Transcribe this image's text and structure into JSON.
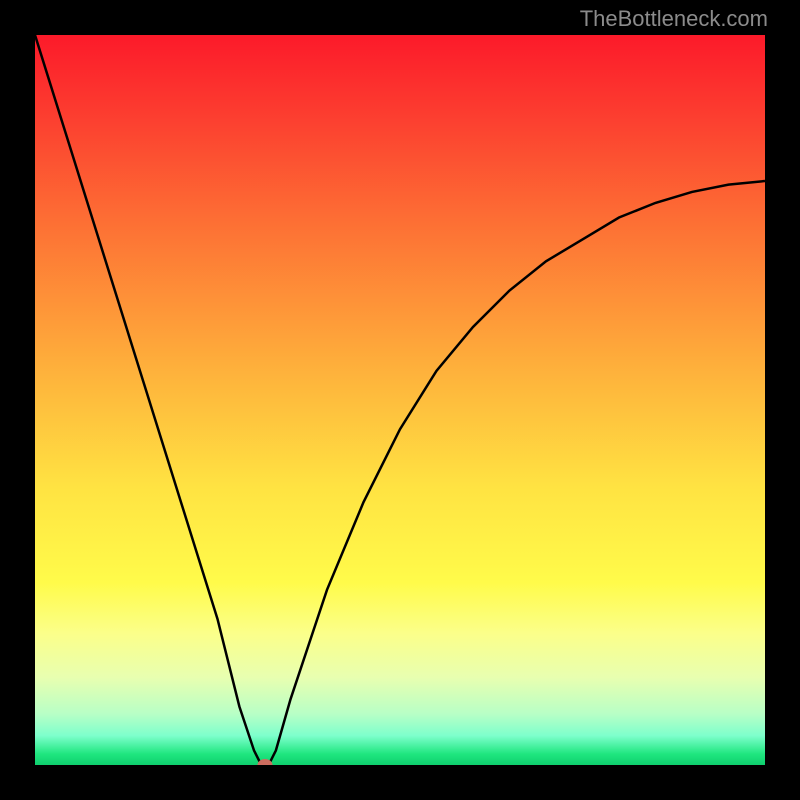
{
  "attribution": "TheBottleneck.com",
  "chart_data": {
    "type": "line",
    "title": "",
    "xlabel": "",
    "ylabel": "",
    "xlim": [
      0,
      100
    ],
    "ylim": [
      0,
      100
    ],
    "x": [
      0,
      5,
      10,
      15,
      20,
      25,
      28,
      30,
      31,
      32,
      33,
      35,
      40,
      45,
      50,
      55,
      60,
      65,
      70,
      75,
      80,
      85,
      90,
      95,
      100
    ],
    "values": [
      100,
      84,
      68,
      52,
      36,
      20,
      8,
      2,
      0,
      0,
      2,
      9,
      24,
      36,
      46,
      54,
      60,
      65,
      69,
      72,
      75,
      77,
      78.5,
      79.5,
      80
    ],
    "minimum_point": {
      "x": 31.5,
      "y": 0
    },
    "gradient_stops": [
      {
        "pos": 0,
        "color": "#fc1a2a"
      },
      {
        "pos": 25,
        "color": "#fd6d34"
      },
      {
        "pos": 50,
        "color": "#fec83e"
      },
      {
        "pos": 75,
        "color": "#fffb4a"
      },
      {
        "pos": 100,
        "color": "#0fcf6e"
      }
    ]
  }
}
